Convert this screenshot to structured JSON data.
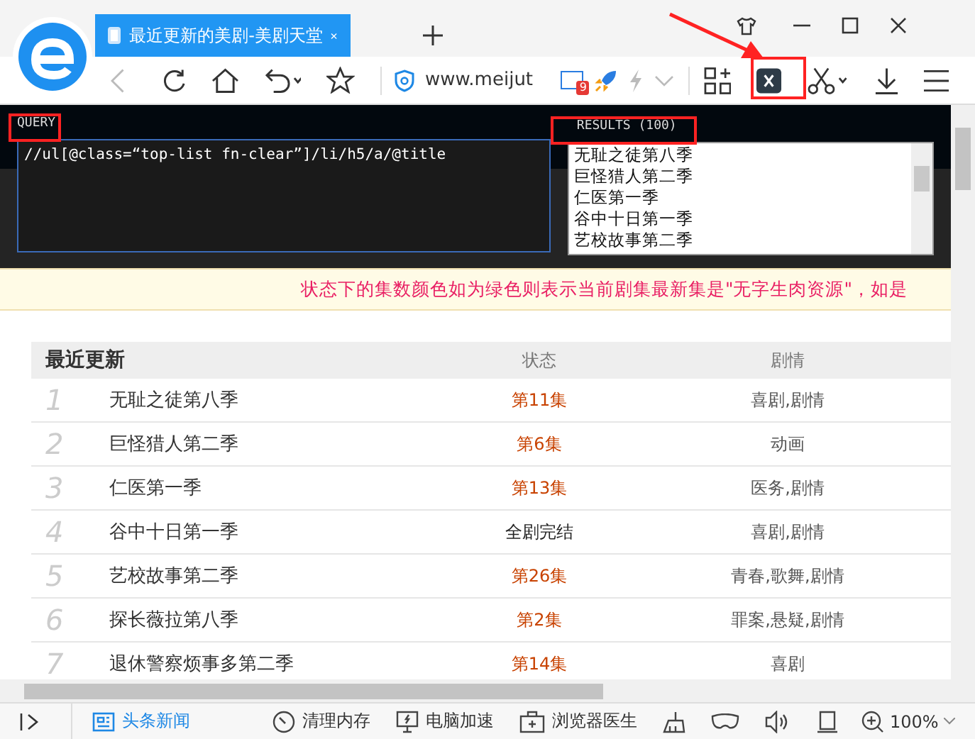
{
  "browser": {
    "tab_title": "最近更新的美剧-美剧天堂",
    "address": "www.meijut",
    "badge": "9"
  },
  "page": {
    "notice": "状态下的集数颜色如为绿色则表示当前剧集最新集是\"无字生肉资源\"，如是"
  },
  "xpath_helper": {
    "query_label": "QUERY",
    "query": "//ul[@class=“top-list  fn-clear”]/li/h5/a/@title",
    "results_label": "RESULTS (100)",
    "results": [
      "无耻之徒第八季",
      "巨怪猎人第二季",
      "仁医第一季",
      "谷中十日第一季",
      "艺校故事第二季"
    ]
  },
  "table": {
    "columns": [
      "最近更新",
      "状态",
      "剧情"
    ],
    "rows": [
      {
        "rank": "1",
        "title": "无耻之徒第八季",
        "status": "第11集",
        "kind": "episode",
        "genre": "喜剧,剧情"
      },
      {
        "rank": "2",
        "title": "巨怪猎人第二季",
        "status": "第6集",
        "kind": "episode",
        "genre": "动画"
      },
      {
        "rank": "3",
        "title": "仁医第一季",
        "status": "第13集",
        "kind": "episode",
        "genre": "医务,剧情"
      },
      {
        "rank": "4",
        "title": "谷中十日第一季",
        "status": "全剧完结",
        "kind": "finished",
        "genre": "喜剧,剧情"
      },
      {
        "rank": "5",
        "title": "艺校故事第二季",
        "status": "第26集",
        "kind": "episode",
        "genre": "青春,歌舞,剧情"
      },
      {
        "rank": "6",
        "title": "探长薇拉第八季",
        "status": "第2集",
        "kind": "episode",
        "genre": "罪案,悬疑,剧情"
      },
      {
        "rank": "7",
        "title": "退休警察烦事多第二季",
        "status": "第14集",
        "kind": "episode",
        "genre": "喜剧"
      }
    ]
  },
  "status_bar": {
    "items": [
      {
        "label": "头条新闻",
        "kind": "news"
      },
      {
        "label": "清理内存",
        "kind": "gauge"
      },
      {
        "label": "电脑加速",
        "kind": "monitor"
      },
      {
        "label": "浏览器医生",
        "kind": "medkit"
      }
    ],
    "zoom": "100%"
  }
}
